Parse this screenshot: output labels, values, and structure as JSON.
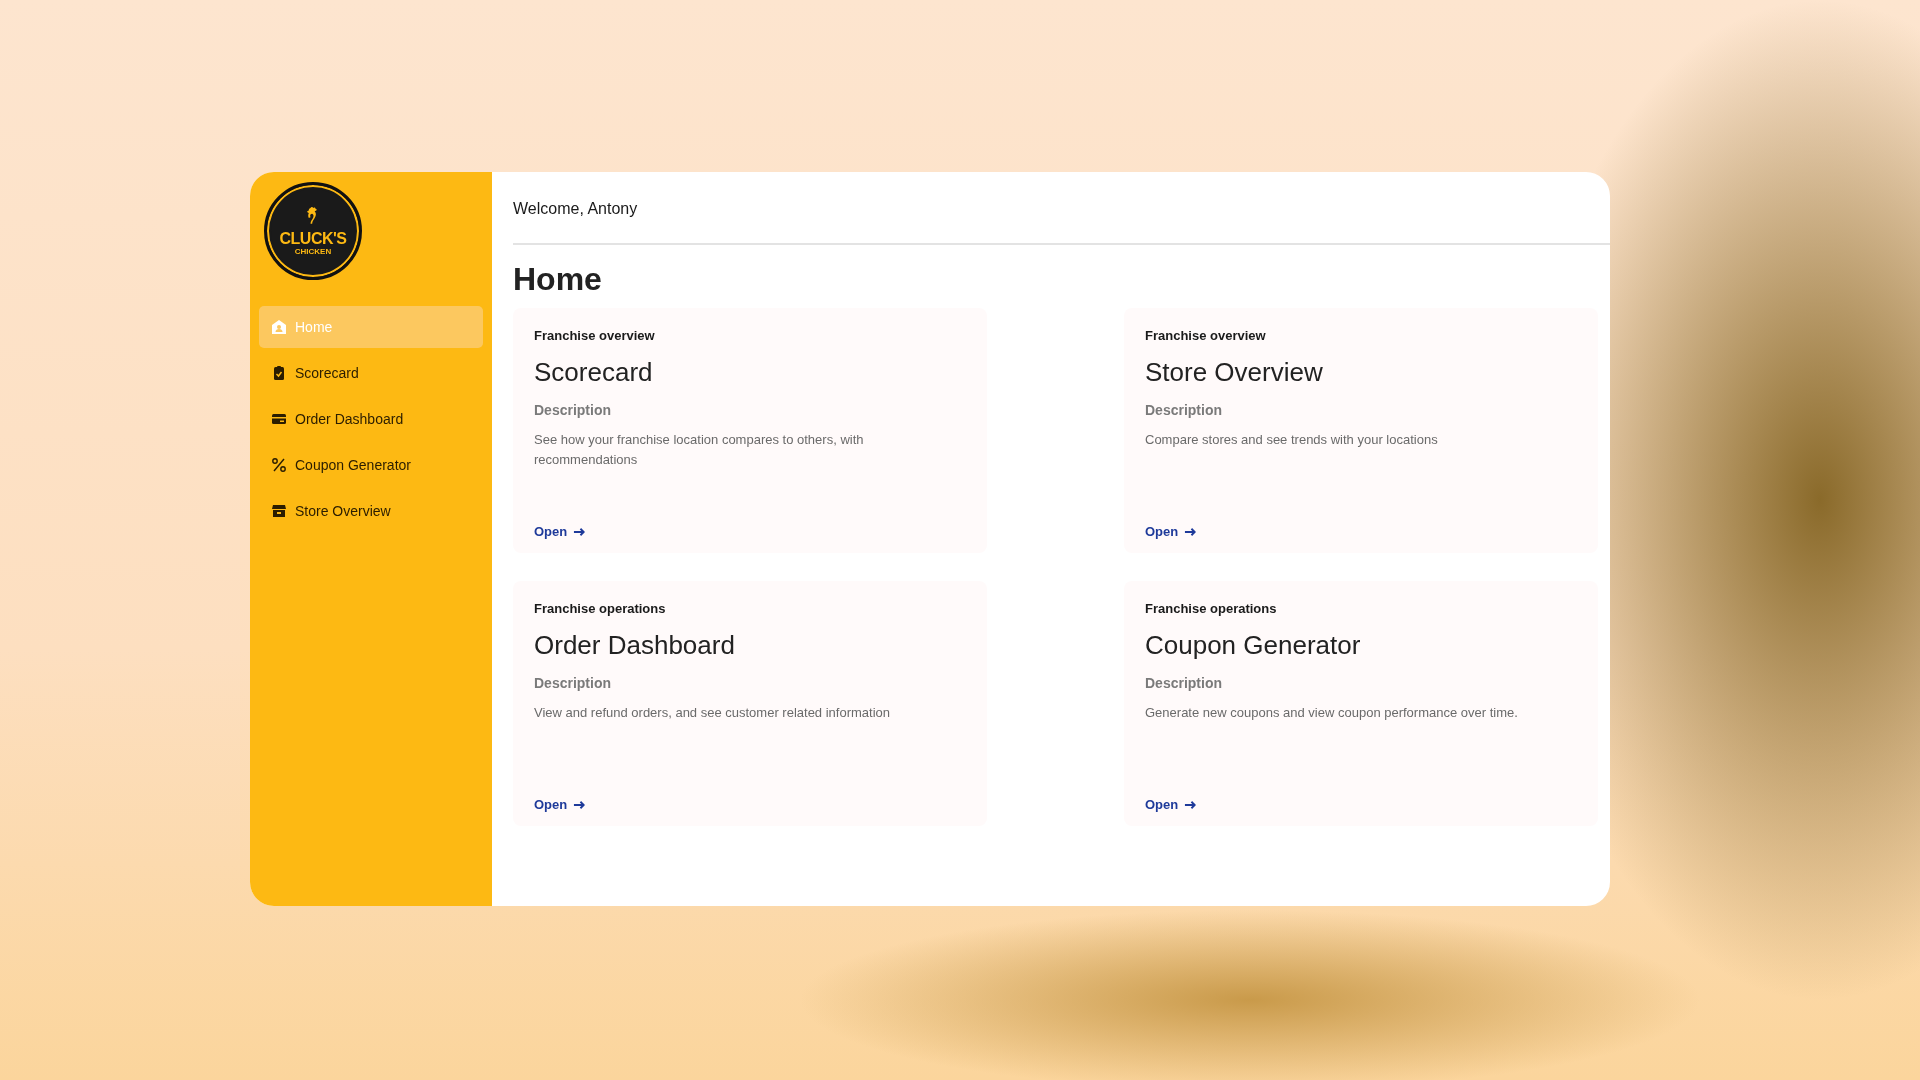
{
  "logo": {
    "line_1": "CLUCK'S",
    "line_2": "CHICKEN"
  },
  "sidebar": {
    "items": [
      {
        "label": "Home",
        "selected": true
      },
      {
        "label": "Scorecard",
        "selected": false
      },
      {
        "label": "Order Dashboard",
        "selected": false
      },
      {
        "label": "Coupon Generator",
        "selected": false
      },
      {
        "label": "Store Overview",
        "selected": false
      }
    ]
  },
  "header": {
    "welcome": "Welcome, Antony"
  },
  "page_title": "Home",
  "cards": [
    {
      "category": "Franchise overview",
      "title": "Scorecard",
      "description_label": "Description",
      "description": "See how your franchise location compares to others, with recommendations",
      "link": "Open"
    },
    {
      "category": "Franchise overview",
      "title": "Store Overview",
      "description_label": "Description",
      "description": "Compare stores and see trends with your locations",
      "link": "Open"
    },
    {
      "category": "Franchise operations",
      "title": "Order Dashboard",
      "description_label": "Description",
      "description": "View and refund orders, and see customer related information",
      "link": "Open"
    },
    {
      "category": "Franchise operations",
      "title": "Coupon Generator",
      "description_label": "Description",
      "description": "Generate new coupons and view coupon performance over time.",
      "link": "Open"
    }
  ]
}
